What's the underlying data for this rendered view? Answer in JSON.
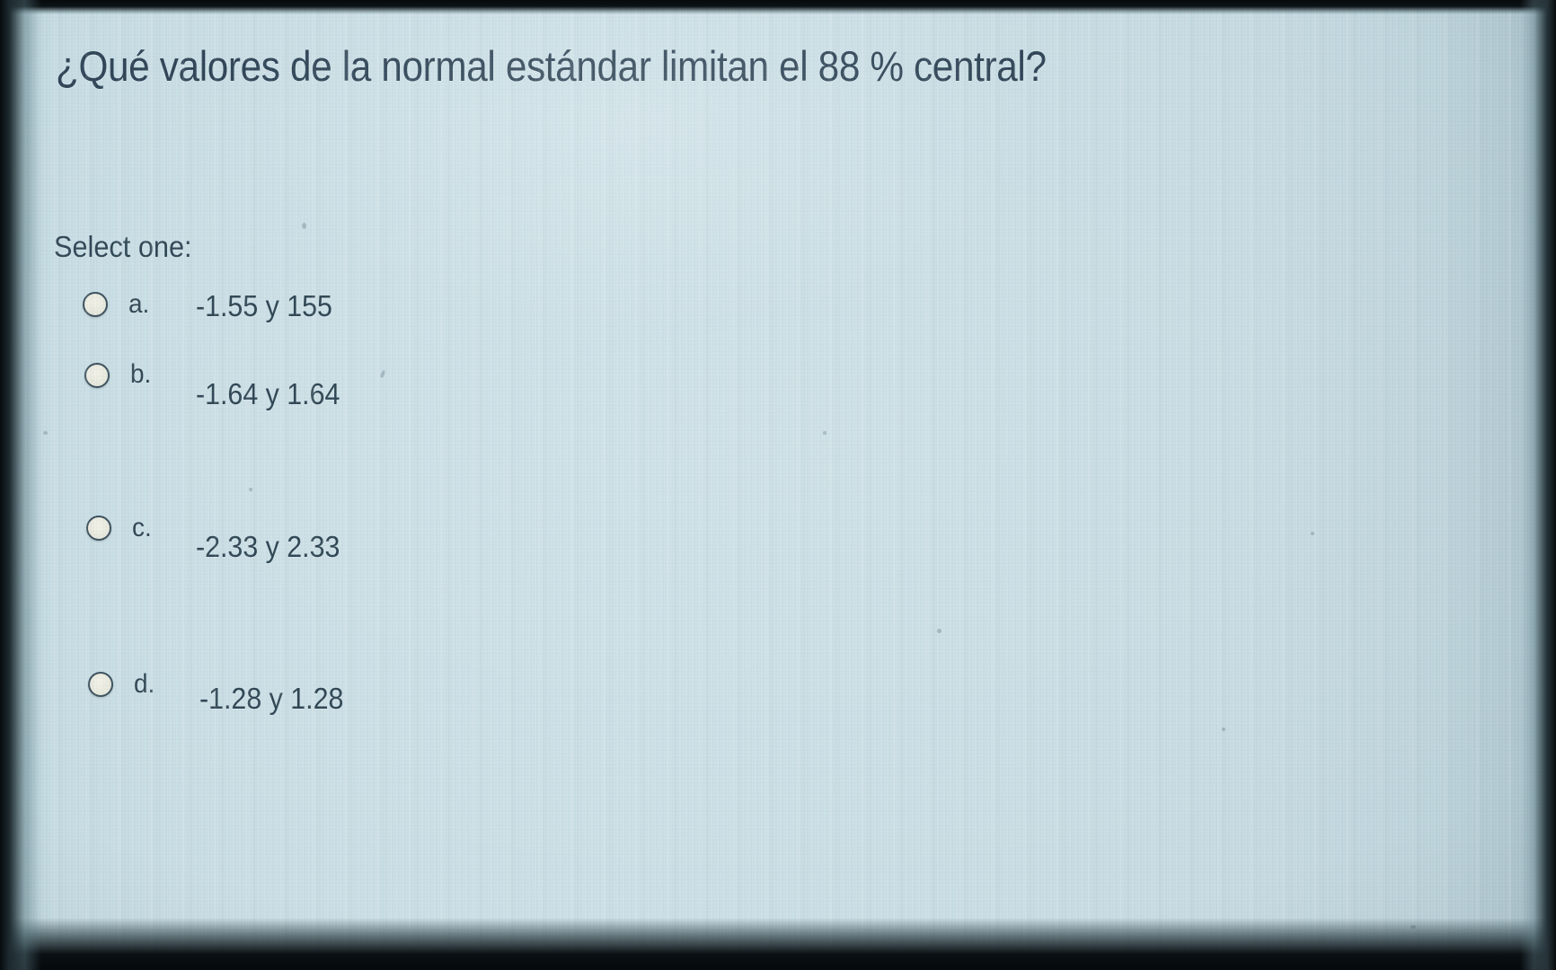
{
  "question": {
    "title": "¿Qué valores de la normal estándar limitan el 88 % central?",
    "instruction": "Select one:"
  },
  "options": [
    {
      "letter": "a.",
      "text": "-1.55 y 155",
      "selected": false
    },
    {
      "letter": "b.",
      "text": "-1.64 y 1.64",
      "selected": false
    },
    {
      "letter": "c.",
      "text": "-2.33 y 2.33",
      "selected": false
    },
    {
      "letter": "d.",
      "text": "-1.28 y 1.28",
      "selected": false
    }
  ],
  "colors": {
    "background": "#c9dee6",
    "text": "#2d4553",
    "radio_border": "#3a4f5c",
    "radio_fill": "#eeeee4"
  }
}
